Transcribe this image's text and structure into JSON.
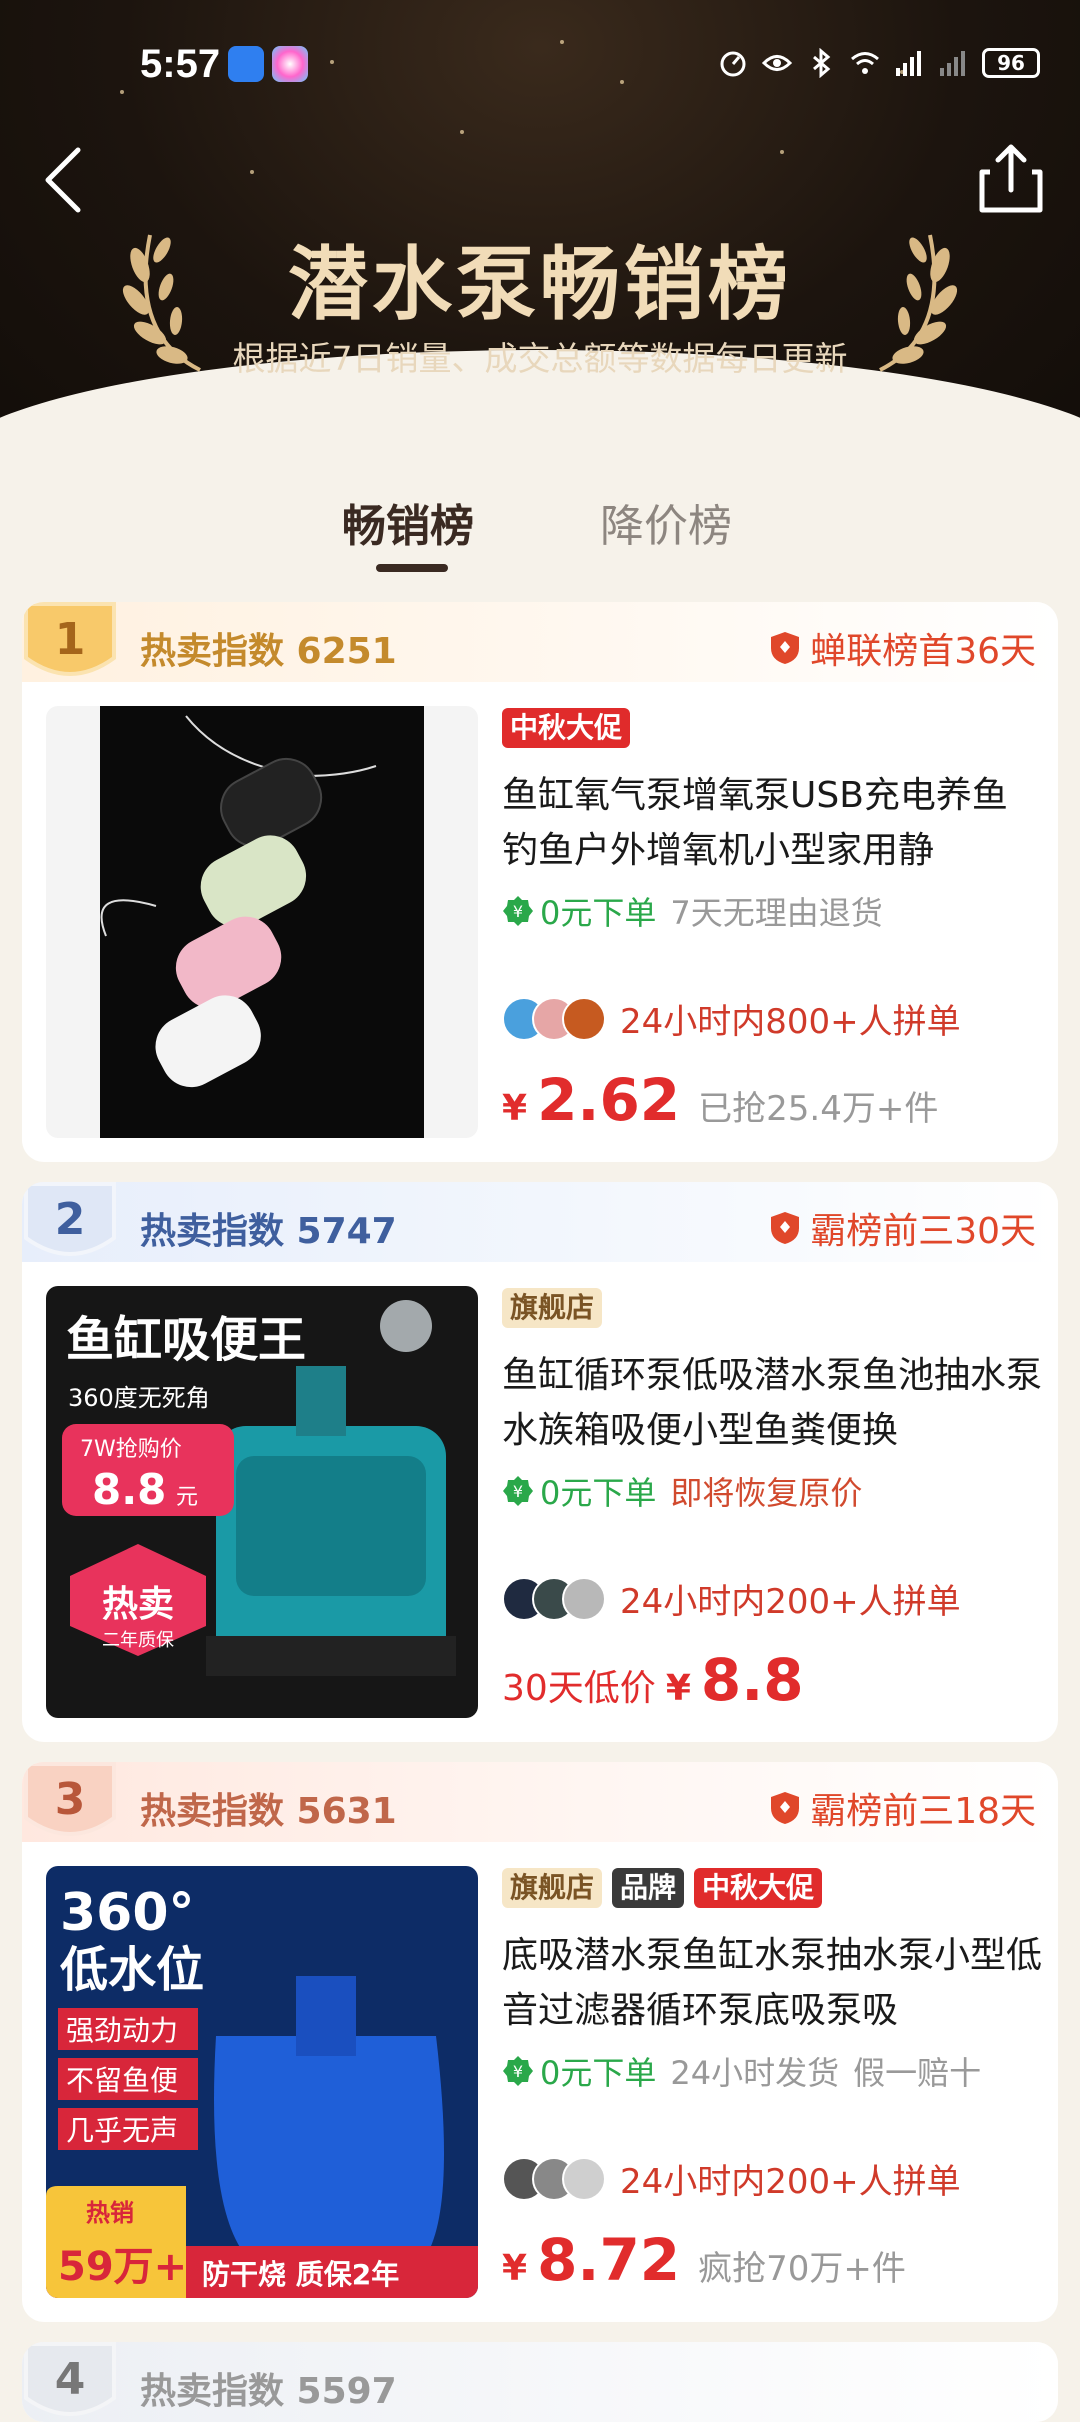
{
  "status_bar": {
    "time": "5:57",
    "battery": "96"
  },
  "header": {
    "title": "潜水泵畅销榜",
    "subtitle": "根据近7日销量、成交总额等数据每日更新"
  },
  "tabs": [
    {
      "label": "畅销榜",
      "active": true
    },
    {
      "label": "降价榜",
      "active": false
    }
  ],
  "products": [
    {
      "rank": "1",
      "hot_index": "热卖指数 6251",
      "rank_tag": "蝉联榜首36天",
      "badges": [
        "中秋大促"
      ],
      "title": "鱼缸氧气泵增氧泵USB充电养鱼钓鱼户外增氧机小型家用静",
      "perk_zero": "0元下单",
      "perk_extra": [
        "7天无理由退货"
      ],
      "group_text": "24小时内800+人拼单",
      "price_prefix": "",
      "price": "2.62",
      "sold": "已抢25.4万+件"
    },
    {
      "rank": "2",
      "hot_index": "热卖指数 5747",
      "rank_tag": "霸榜前三30天",
      "badges": [
        "旗舰店"
      ],
      "title": "鱼缸循环泵低吸潜水泵鱼池抽水泵水族箱吸便小型鱼粪便换",
      "perk_zero": "0元下单",
      "perk_extra": [
        "即将恢复原价"
      ],
      "group_text": "24小时内200+人拼单",
      "price_prefix": "30天低价",
      "price": "8.8",
      "sold": "",
      "image_text": {
        "headline": "鱼缸吸便王",
        "sub": "360度无死角",
        "promo_label": "7W抢购价",
        "promo_price": "8.8",
        "promo_unit": "元",
        "hot": "热卖",
        "warranty": "二年质保"
      }
    },
    {
      "rank": "3",
      "hot_index": "热卖指数 5631",
      "rank_tag": "霸榜前三18天",
      "badges": [
        "旗舰店",
        "品牌",
        "中秋大促"
      ],
      "title": "底吸潜水泵鱼缸水泵抽水泵小型低音过滤器循环泵底吸泵吸",
      "perk_zero": "0元下单",
      "perk_extra": [
        "24小时发货",
        "假一赔十"
      ],
      "group_text": "24小时内200+人拼单",
      "price_prefix": "",
      "price": "8.72",
      "sold": "疯抢70万+件",
      "image_text": {
        "headline1": "360°",
        "headline2": "低水位",
        "points": [
          "强劲动力",
          "不留鱼便",
          "几乎无声"
        ],
        "sales_label": "热销",
        "sales_num": "59万+",
        "bottom": "防干烧 质保2年"
      }
    },
    {
      "rank": "4",
      "hot_index": "热卖指数 5597"
    }
  ],
  "colors": {
    "price_red": "#e12c2c",
    "gold": "#f1dcb8",
    "green": "#2aa84a"
  }
}
